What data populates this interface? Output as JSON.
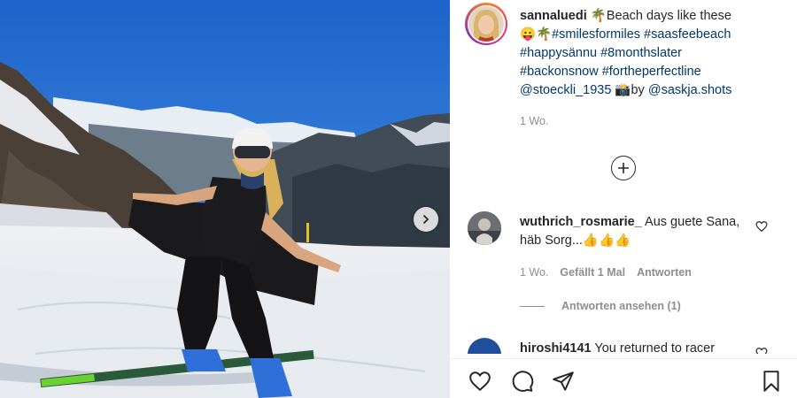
{
  "post": {
    "username": "sannaluedi",
    "caption_prefix": " ",
    "caption_emoji_1": "🌴",
    "caption_text": "Beach days like these",
    "caption_emoji_2": "😛🌴",
    "hashtags_line1": "#smilesformiles #saasfeebeach",
    "hashtags": [
      "#happysännu",
      "#8monthslater",
      "#backonsnow",
      "#fortheperfectline"
    ],
    "mention_1": "@stoeckli_1935",
    "camera_emoji": "📸",
    "by_text": "by",
    "mention_2": "@saskja.shots",
    "time": "1 Wo."
  },
  "comments": [
    {
      "username": "wuthrich_rosmarie_",
      "text": "Aus guete Sana, häb Sorg...👍👍👍",
      "time": "1 Wo.",
      "likes": "Gefällt 1 Mal",
      "reply": "Antworten",
      "view_replies": "Antworten ansehen (1)"
    },
    {
      "username": "hiroshi4141",
      "text": "You returned to racer"
    }
  ],
  "icons": {
    "next": "chevron-right-icon",
    "load_more": "plus-circle-icon",
    "like": "heart-icon",
    "comment": "comment-icon",
    "share": "paper-plane-icon",
    "save": "bookmark-icon"
  }
}
